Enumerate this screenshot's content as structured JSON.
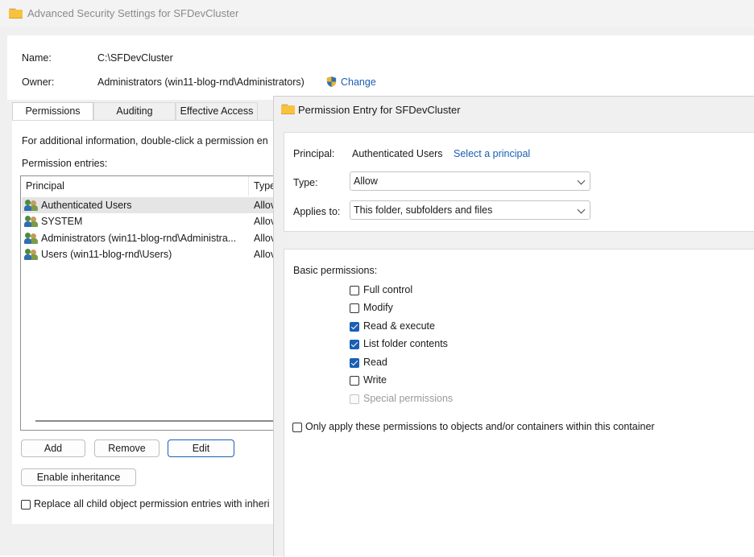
{
  "main_window": {
    "title": "Advanced Security Settings for SFDevCluster",
    "name_label": "Name:",
    "name_value": "C:\\SFDevCluster",
    "owner_label": "Owner:",
    "owner_value": "Administrators (win11-blog-rnd\\Administrators)",
    "change_link": "Change",
    "tabs": [
      {
        "label": "Permissions",
        "active": true
      },
      {
        "label": "Auditing",
        "active": false
      },
      {
        "label": "Effective Access",
        "active": false
      }
    ],
    "info_text": "For additional information, double-click a permission en",
    "entries_label": "Permission entries:",
    "columns": [
      "Principal",
      "Type"
    ],
    "entries": [
      {
        "principal": "Authenticated Users",
        "type": "Allov",
        "selected": true
      },
      {
        "principal": "SYSTEM",
        "type": "Allov",
        "selected": false
      },
      {
        "principal": "Administrators (win11-blog-rnd\\Administra...",
        "type": "Allov",
        "selected": false
      },
      {
        "principal": "Users (win11-blog-rnd\\Users)",
        "type": "Allov",
        "selected": false
      }
    ],
    "buttons": {
      "add": "Add",
      "remove": "Remove",
      "edit": "Edit"
    },
    "enable_inheritance": "Enable inheritance",
    "replace_checkbox": "Replace all child object permission entries with inheri"
  },
  "dialog": {
    "title": "Permission Entry for SFDevCluster",
    "principal_label": "Principal:",
    "principal_value": "Authenticated Users",
    "select_principal_link": "Select a principal",
    "type_label": "Type:",
    "type_value": "Allow",
    "applies_label": "Applies to:",
    "applies_value": "This folder, subfolders and files",
    "basic_permissions_label": "Basic permissions:",
    "permissions": [
      {
        "label": "Full control",
        "checked": false,
        "disabled": false
      },
      {
        "label": "Modify",
        "checked": false,
        "disabled": false
      },
      {
        "label": "Read & execute",
        "checked": true,
        "disabled": false
      },
      {
        "label": "List folder contents",
        "checked": true,
        "disabled": false
      },
      {
        "label": "Read",
        "checked": true,
        "disabled": false
      },
      {
        "label": "Write",
        "checked": false,
        "disabled": false
      },
      {
        "label": "Special permissions",
        "checked": false,
        "disabled": true
      }
    ],
    "only_apply_label": "Only apply these permissions to objects and/or containers within this container",
    "only_apply_checked": false
  },
  "colors": {
    "accent": "#1a5fb4",
    "folder": "#f7c23d"
  }
}
